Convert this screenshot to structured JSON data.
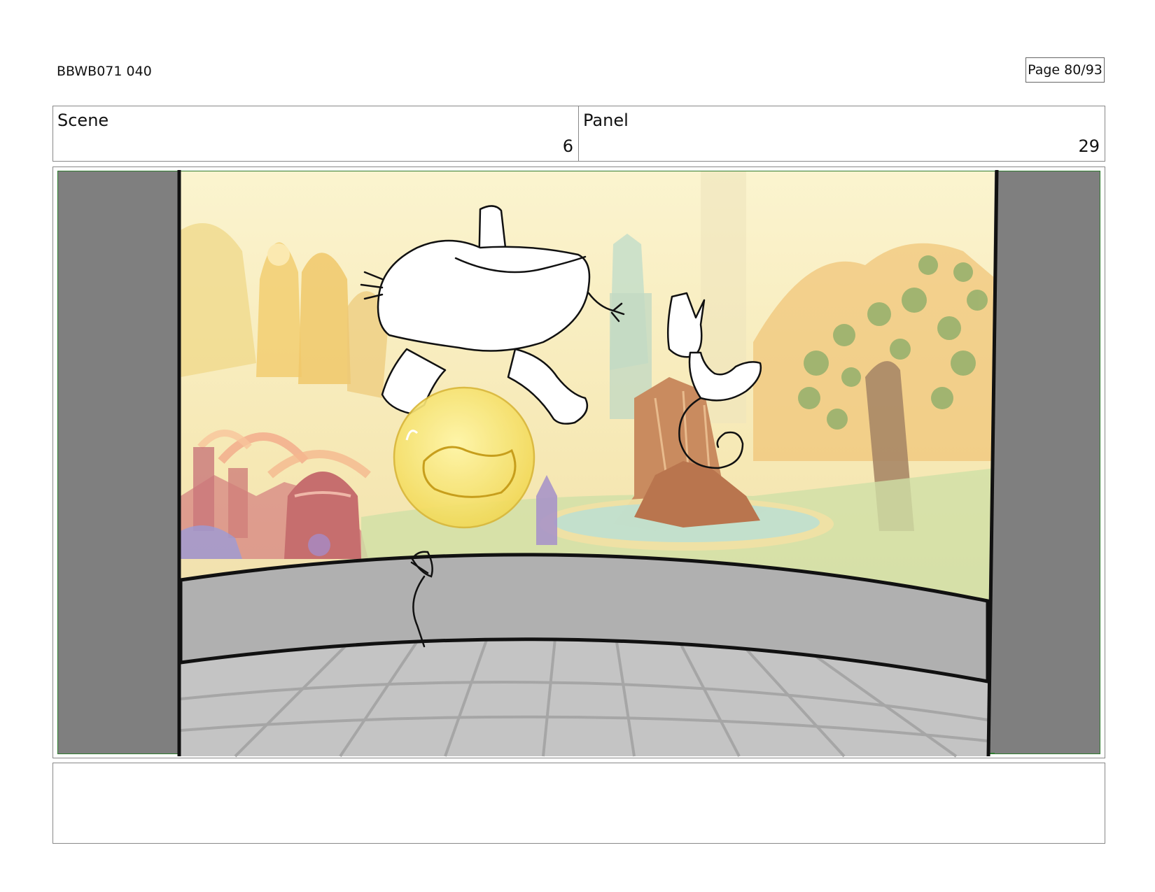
{
  "header": {
    "doc_id": "BBWB071 040",
    "page": "Page 80/93"
  },
  "scene": {
    "label": "Scene",
    "value": "6"
  },
  "panel": {
    "label": "Panel",
    "value": "29"
  },
  "notes": {
    "text": ""
  }
}
